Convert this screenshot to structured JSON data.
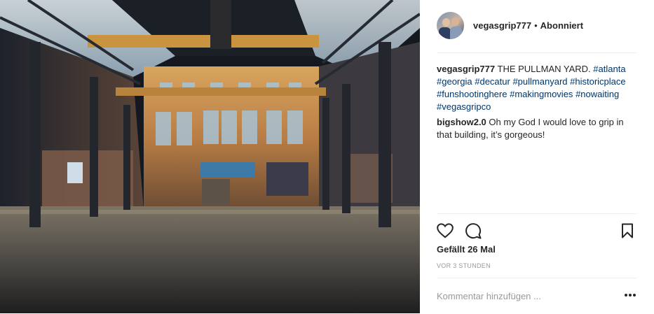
{
  "post": {
    "username": "vegasgrip777",
    "separator": "•",
    "follow_label": "Abonniert",
    "caption": {
      "text": "THE PULLMAN YARD.",
      "hashtags": [
        "#atlanta",
        "#georgia",
        "#decatur",
        "#pullmanyard",
        "#historicplace",
        "#funshootinghere",
        "#makingmovies",
        "#nowaiting",
        "#vegasgripco"
      ]
    },
    "comments": [
      {
        "username": "bigshow2.0",
        "text": "Oh my God I would love to grip in that building, it’s gorgeous!"
      }
    ],
    "likes_label": "Gefällt 26 Mal",
    "timestamp": "VOR 3 STUNDEN",
    "add_comment_placeholder": "Kommentar hinzufügen ...",
    "more_label": "•••"
  },
  "icons": [
    "heart-icon",
    "comment-icon",
    "bookmark-icon",
    "more-options-icon"
  ]
}
